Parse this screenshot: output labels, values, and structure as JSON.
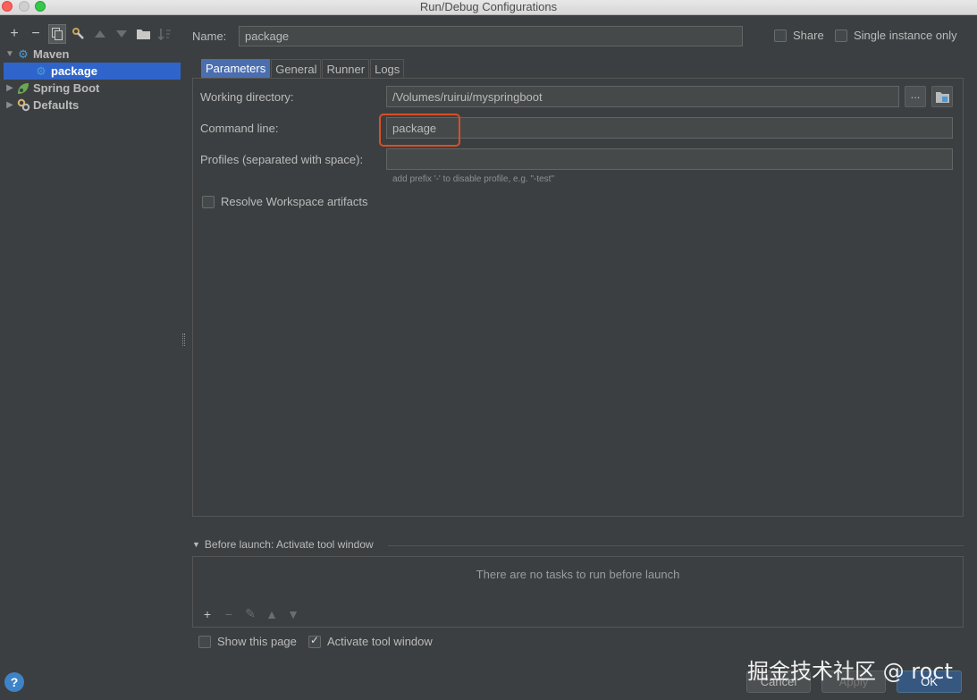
{
  "window": {
    "title": "Run/Debug Configurations"
  },
  "toolbar": {
    "add": "+",
    "remove": "−",
    "copy": "⧉",
    "edit": "🔧",
    "up": "▲",
    "down": "▼",
    "folder": "📁",
    "sort": "↓"
  },
  "tree": {
    "maven": {
      "label": "Maven",
      "icon": "gear-icon"
    },
    "package": {
      "label": "package",
      "icon": "gear-icon"
    },
    "spring_boot": {
      "label": "Spring Boot",
      "icon": "spring-leaf-icon"
    },
    "defaults": {
      "label": "Defaults",
      "icon": "gears-icon"
    }
  },
  "name": {
    "label": "Name:",
    "value": "package"
  },
  "share": {
    "label": "Share",
    "checked": false
  },
  "single_instance": {
    "label": "Single instance only",
    "checked": false
  },
  "tabs": [
    "Parameters",
    "General",
    "Runner",
    "Logs"
  ],
  "parameters": {
    "working_dir_label": "Working directory:",
    "working_dir_value": "/Volumes/ruirui/myspringboot",
    "browse_label": "...",
    "command_label": "Command line:",
    "command_value": "package",
    "profiles_label": "Profiles (separated with space):",
    "profiles_value": "",
    "profiles_hint": "add prefix '-' to disable profile, e.g. \"-test\"",
    "resolve_label": "Resolve Workspace artifacts"
  },
  "before_launch": {
    "header": "Before launch: Activate tool window",
    "empty": "There are no tasks to run before launch"
  },
  "footer": {
    "show_page": "Show this page",
    "activate_tool": "Activate tool window",
    "cancel": "Cancel",
    "apply": "Apply",
    "ok": "OK",
    "help": "?"
  },
  "watermark": "掘金技术社区 @ roct",
  "colors": {
    "selection": "#2f65ca",
    "active_tab": "#4b6eaf",
    "highlight": "#d94f25",
    "ok_button": "#365880"
  }
}
